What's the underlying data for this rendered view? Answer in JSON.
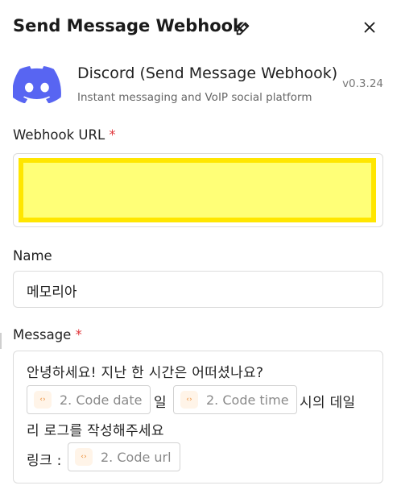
{
  "header": {
    "title": "Send Message Webhook"
  },
  "app": {
    "name": "Discord (Send Message Webhook)",
    "description": "Instant messaging and VoIP social platform",
    "version": "v0.3.24",
    "brand_color": "#5865F2"
  },
  "fields": {
    "webhook_url": {
      "label": "Webhook URL",
      "required_mark": "*",
      "value": "",
      "highlight_color": "#FFFF77",
      "highlight_border": "#FFE600"
    },
    "name": {
      "label": "Name",
      "value": "메모리아"
    },
    "message": {
      "label": "Message",
      "required_mark": "*",
      "line1": "안녕하세요! 지난 한 시간은 어떠셨나요?",
      "chip_date": "2. Code date",
      "text_il": "일",
      "chip_time": "2. Code time",
      "text_after_time": "시의 데일",
      "line3": "리 로그를 작성해주세요",
      "text_link": "링크 :",
      "chip_url": "2. Code url"
    }
  },
  "icons": {
    "edit": "pencil-icon",
    "close": "close-icon",
    "code_chip": "code-icon"
  }
}
